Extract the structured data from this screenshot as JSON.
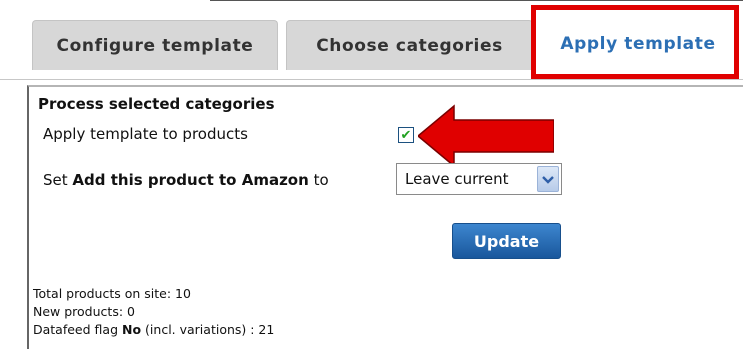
{
  "tabs": [
    {
      "label": "Configure template",
      "active": false
    },
    {
      "label": "Choose categories",
      "active": false
    },
    {
      "label": "Apply template",
      "active": true
    }
  ],
  "colors": {
    "highlight": "#e00000",
    "active_tab_text": "#2c6fb4",
    "check": "#21a121"
  },
  "section": {
    "title": "Process selected categories"
  },
  "apply_row": {
    "label": "Apply template to products",
    "checked": true
  },
  "amazon_row": {
    "prefix": "Set",
    "field_name": "Add this product to Amazon",
    "suffix": "to",
    "select_value": "Leave current"
  },
  "update_button": "Update",
  "stats": {
    "total_products": "Total products on site: 10",
    "new_products": "New products: 0",
    "datafeed_prefix": "Datafeed flag",
    "datafeed_flag": "No",
    "datafeed_suffix": "(incl. variations) : 21"
  },
  "icons": {
    "check": "checkmark-icon",
    "dropdown": "chevron-down-icon",
    "arrow": "red-arrow-icon"
  }
}
